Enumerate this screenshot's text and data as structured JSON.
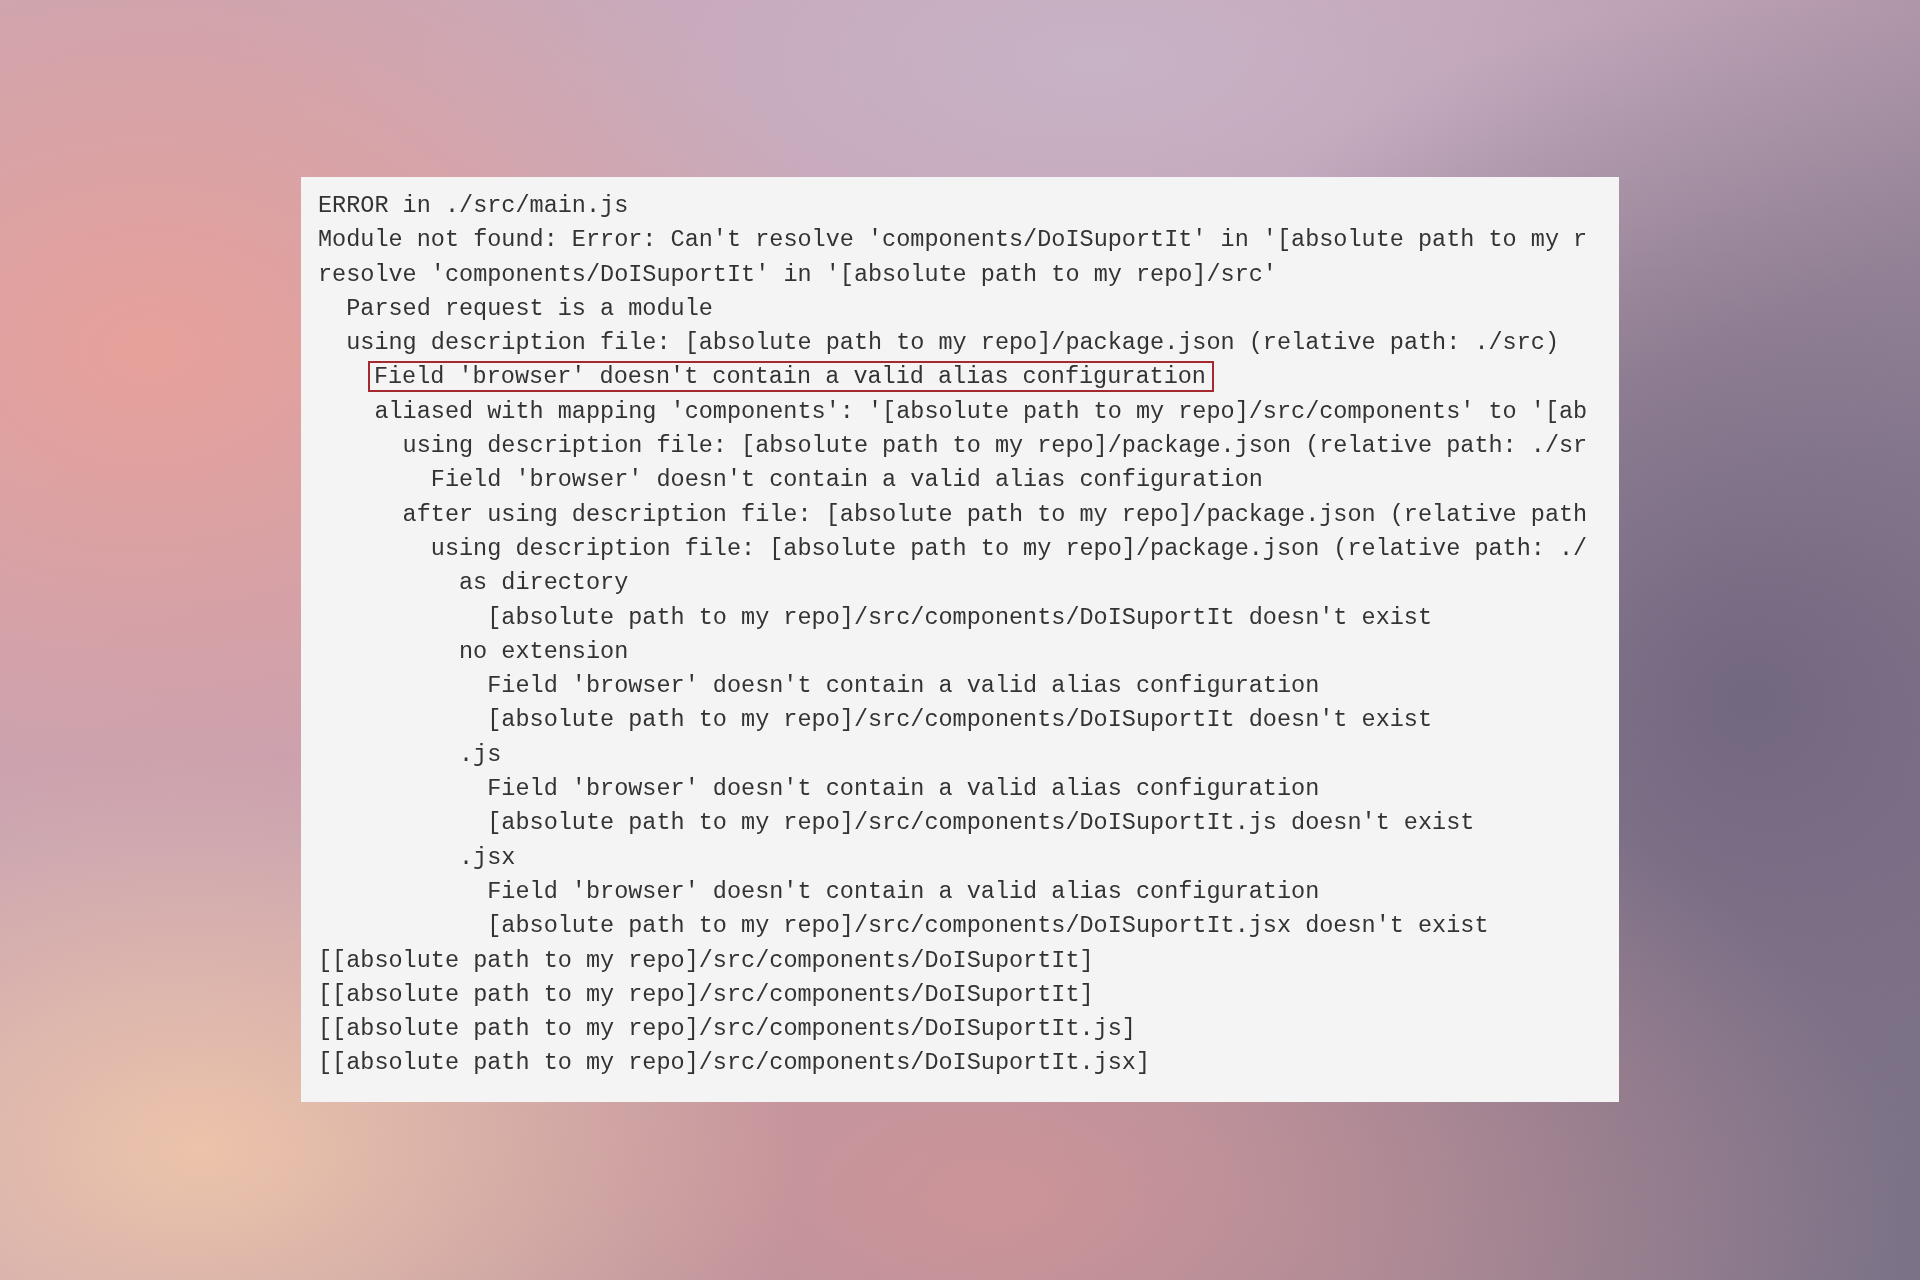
{
  "console": {
    "lines": [
      {
        "text": "ERROR in ./src/main.js",
        "highlighted": false
      },
      {
        "text": "Module not found: Error: Can't resolve 'components/DoISuportIt' in '[absolute path to my r",
        "highlighted": false
      },
      {
        "text": "resolve 'components/DoISuportIt' in '[absolute path to my repo]/src'",
        "highlighted": false,
        "children": [
          {
            "text": "Parsed request is a module",
            "highlighted": false
          },
          {
            "text": "using description file: [absolute path to my repo]/package.json (relative path: ./src)",
            "highlighted": false,
            "children": [
              {
                "text": "Field 'browser' doesn't contain a valid alias configuration",
                "highlighted": true
              },
              {
                "text": "aliased with mapping 'components': '[absolute path to my repo]/src/components' to '[ab",
                "highlighted": false,
                "children": [
                  {
                    "text": "using description file: [absolute path to my repo]/package.json (relative path: ./sr",
                    "highlighted": false,
                    "children": [
                      {
                        "text": "Field 'browser' doesn't contain a valid alias configuration",
                        "highlighted": false
                      }
                    ]
                  },
                  {
                    "text": "after using description file: [absolute path to my repo]/package.json (relative path",
                    "highlighted": false,
                    "children": [
                      {
                        "text": "using description file: [absolute path to my repo]/package.json (relative path: ./",
                        "highlighted": false,
                        "children": [
                          {
                            "text": "as directory",
                            "highlighted": false,
                            "children": [
                              {
                                "text": "[absolute path to my repo]/src/components/DoISuportIt doesn't exist",
                                "highlighted": false
                              }
                            ]
                          },
                          {
                            "text": "no extension",
                            "highlighted": false,
                            "children": [
                              {
                                "text": "Field 'browser' doesn't contain a valid alias configuration",
                                "highlighted": false
                              },
                              {
                                "text": "[absolute path to my repo]/src/components/DoISuportIt doesn't exist",
                                "highlighted": false
                              }
                            ]
                          },
                          {
                            "text": ".js",
                            "highlighted": false,
                            "children": [
                              {
                                "text": "Field 'browser' doesn't contain a valid alias configuration",
                                "highlighted": false
                              },
                              {
                                "text": "[absolute path to my repo]/src/components/DoISuportIt.js doesn't exist",
                                "highlighted": false
                              }
                            ]
                          },
                          {
                            "text": ".jsx",
                            "highlighted": false,
                            "children": [
                              {
                                "text": "Field 'browser' doesn't contain a valid alias configuration",
                                "highlighted": false
                              },
                              {
                                "text": "[absolute path to my repo]/src/components/DoISuportIt.jsx doesn't exist",
                                "highlighted": false
                              }
                            ]
                          }
                        ]
                      }
                    ]
                  }
                ]
              }
            ]
          }
        ]
      },
      {
        "text": "[[absolute path to my repo]/src/components/DoISuportIt]",
        "highlighted": false
      },
      {
        "text": "[[absolute path to my repo]/src/components/DoISuportIt]",
        "highlighted": false
      },
      {
        "text": "[[absolute path to my repo]/src/components/DoISuportIt.js]",
        "highlighted": false
      },
      {
        "text": "[[absolute path to my repo]/src/components/DoISuportIt.jsx]",
        "highlighted": false
      }
    ]
  }
}
